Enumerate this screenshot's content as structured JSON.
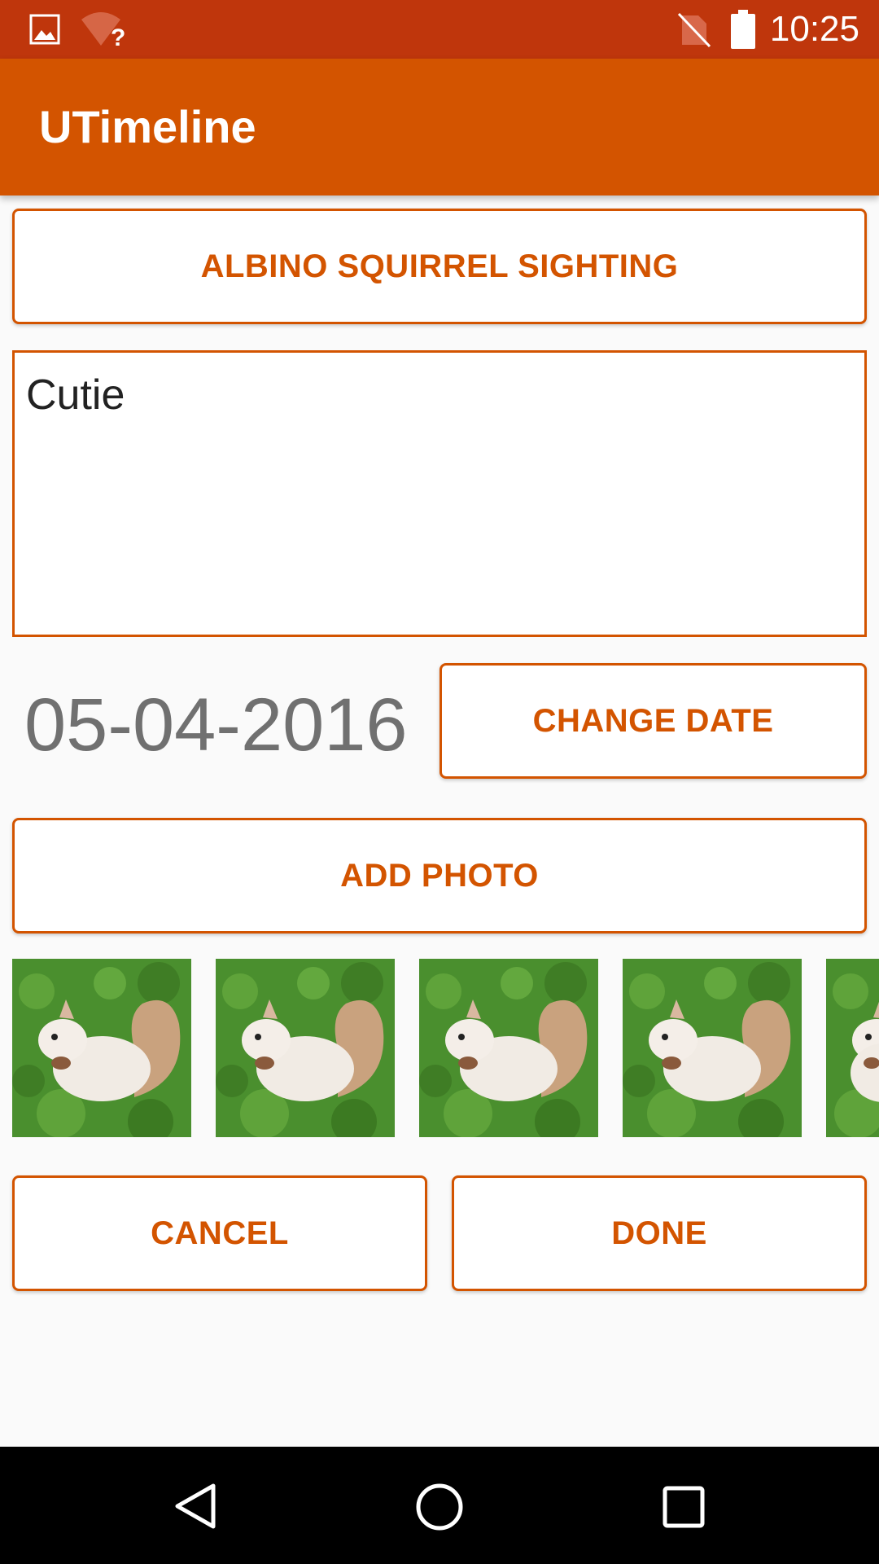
{
  "status_bar": {
    "time": "10:25",
    "icons": [
      "image-icon",
      "wifi-unknown-icon",
      "no-sim-icon",
      "battery-icon"
    ]
  },
  "app_bar": {
    "title": "UTimeline"
  },
  "form": {
    "title_button": "ALBINO SQUIRREL SIGHTING",
    "description": "Cutie",
    "date": "05-04-2016",
    "change_date_label": "CHANGE DATE",
    "add_photo_label": "ADD PHOTO",
    "photos": [
      "albino-squirrel-photo",
      "albino-squirrel-photo",
      "albino-squirrel-photo",
      "albino-squirrel-photo",
      "albino-squirrel-photo"
    ],
    "cancel_label": "CANCEL",
    "done_label": "DONE"
  },
  "nav_bar": {
    "icons": [
      "back-icon",
      "home-icon",
      "recents-icon"
    ]
  },
  "colors": {
    "status_bar": "#bf360c",
    "app_bar": "#d35400",
    "accent": "#d35400",
    "background": "#fafafa",
    "date_text": "#707070"
  }
}
